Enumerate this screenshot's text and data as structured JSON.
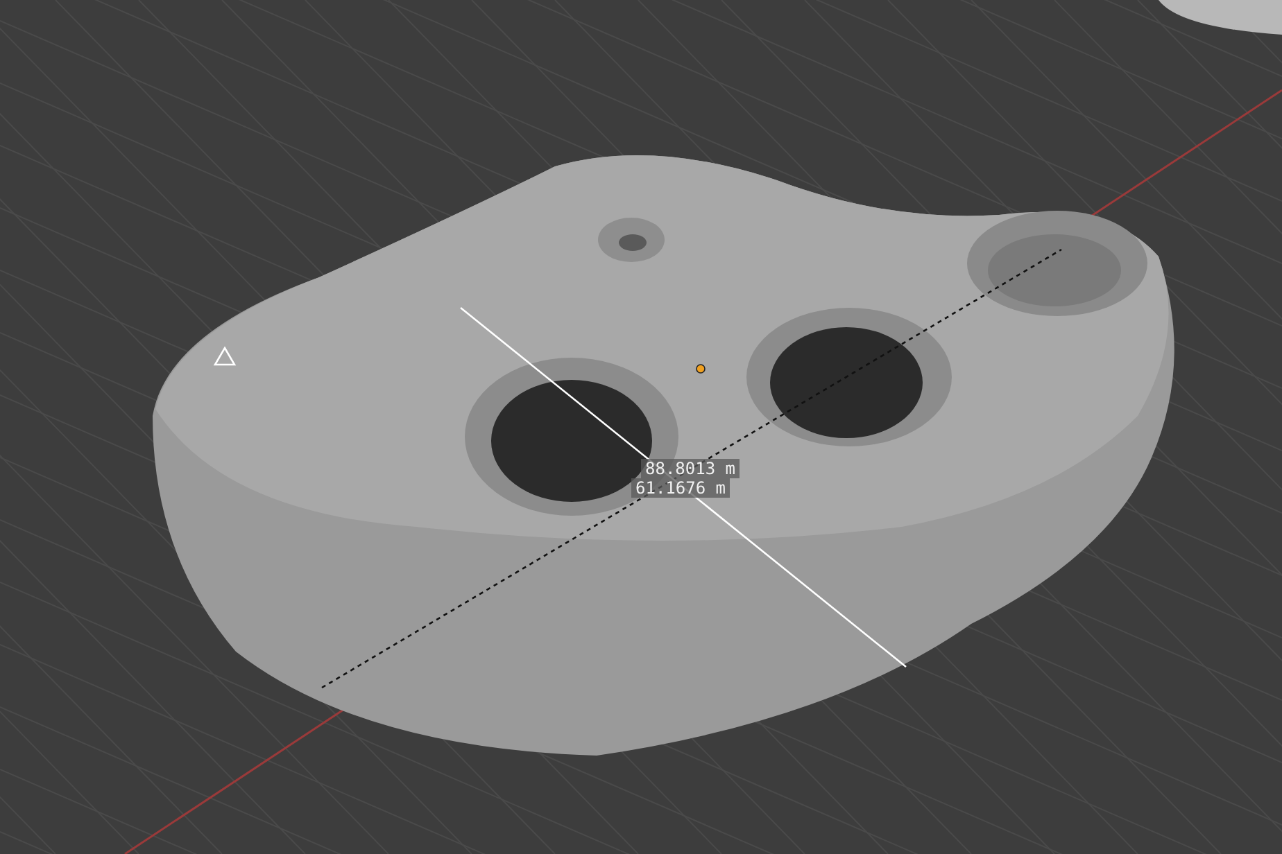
{
  "viewport": {
    "measurements": [
      {
        "label": "88.8013 m"
      },
      {
        "label": "61.1676 m"
      }
    ]
  }
}
